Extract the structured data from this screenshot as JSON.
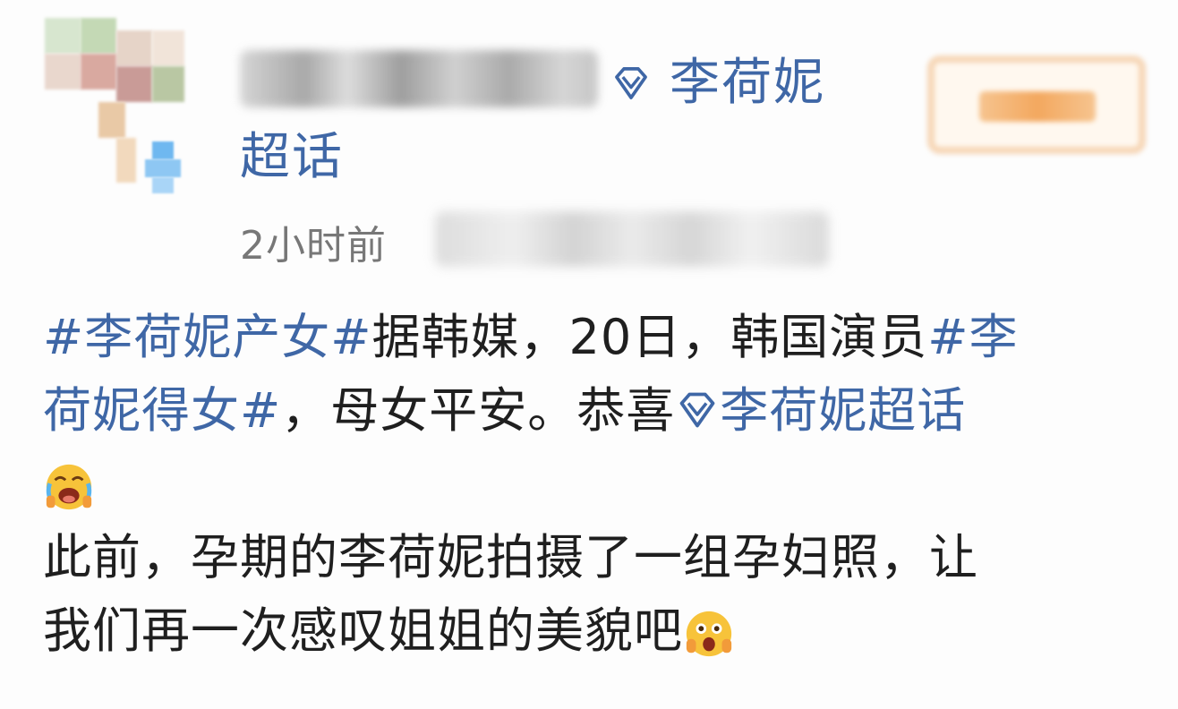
{
  "post": {
    "supertopic": {
      "name": "李荷妮",
      "suffix": "超话",
      "icon": "diamond-icon"
    },
    "timestamp": "2小时前",
    "text": {
      "tag1": "#李荷妮产女#",
      "line1_rest": "据韩媒，20日，韩国演员",
      "tag2_part1": "#李",
      "tag2_part2": "荷妮得女#",
      "line2_rest": "，母女平安。恭喜",
      "super_link": "李荷妮超话",
      "emoji1": "crying-laughing-emoji",
      "line4": "此前，孕期的李荷妮拍摄了一组孕妇照，让",
      "line5": "我们再一次感叹姐姐的美貌吧",
      "emoji2": "amazed-emoji"
    }
  },
  "colors": {
    "link": "#3f67a6",
    "text": "#1f1f1f",
    "meta": "#777777"
  }
}
